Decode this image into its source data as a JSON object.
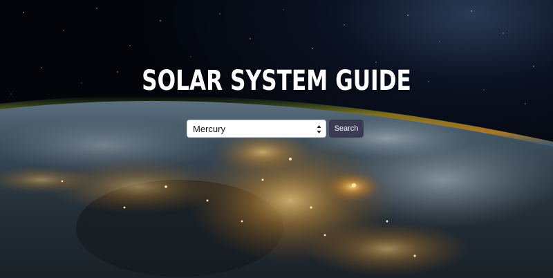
{
  "hero": {
    "title": "SOLAR SYSTEM GUIDE",
    "background": "earth-at-night-from-orbit-image"
  },
  "search": {
    "selected_planet": "Mercury",
    "button_label": "Search"
  },
  "colors": {
    "button_bg": "#3a3b52",
    "text": "#ffffff"
  }
}
